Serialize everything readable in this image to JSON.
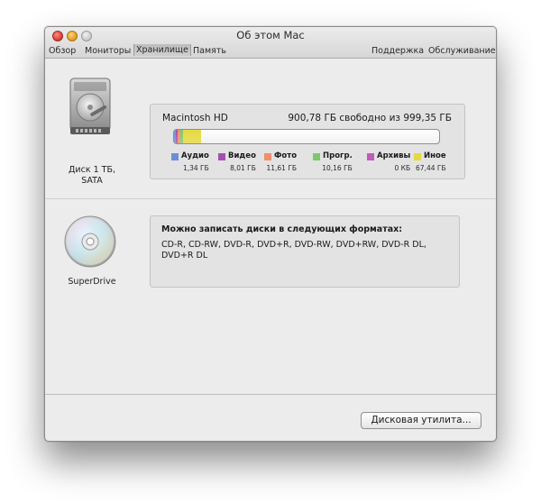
{
  "window": {
    "title": "Об этом Mac",
    "tabs_left": [
      "Обзор",
      "Мониторы",
      "Хранилище",
      "Память"
    ],
    "active_tab": "Хранилище",
    "tabs_right": [
      "Поддержка",
      "Обслуживание"
    ]
  },
  "disk": {
    "label_line1": "Диск 1 ТБ,",
    "label_line2": "SATA",
    "volume_name": "Macintosh HD",
    "free_text": "900,78 ГБ свободно из 999,35 ГБ",
    "total_gb": 999.35,
    "legend": [
      {
        "name": "Аудио",
        "size": "1,34 ГБ",
        "color": "#6b8fd6",
        "gb": 1.34
      },
      {
        "name": "Видео",
        "size": "8,01 ГБ",
        "color": "#a64fb0",
        "gb": 8.01
      },
      {
        "name": "Фото",
        "size": "11,61 ГБ",
        "color": "#f0906a",
        "gb": 11.61
      },
      {
        "name": "Прогр.",
        "size": "10,16 ГБ",
        "color": "#7ec86a",
        "gb": 10.16
      },
      {
        "name": "Архивы",
        "size": "0 КБ",
        "color": "#c45bb8",
        "gb": 0
      },
      {
        "name": "Иное",
        "size": "67,44 ГБ",
        "color": "#e6d840",
        "gb": 67.44
      }
    ]
  },
  "superdrive": {
    "label": "SuperDrive",
    "formats_title": "Можно записать диски в следующих форматах:",
    "formats": "CD-R, CD-RW, DVD-R, DVD+R, DVD-RW, DVD+RW, DVD-R DL, DVD+R DL"
  },
  "footer": {
    "disk_utility_button": "Дисковая утилита..."
  }
}
